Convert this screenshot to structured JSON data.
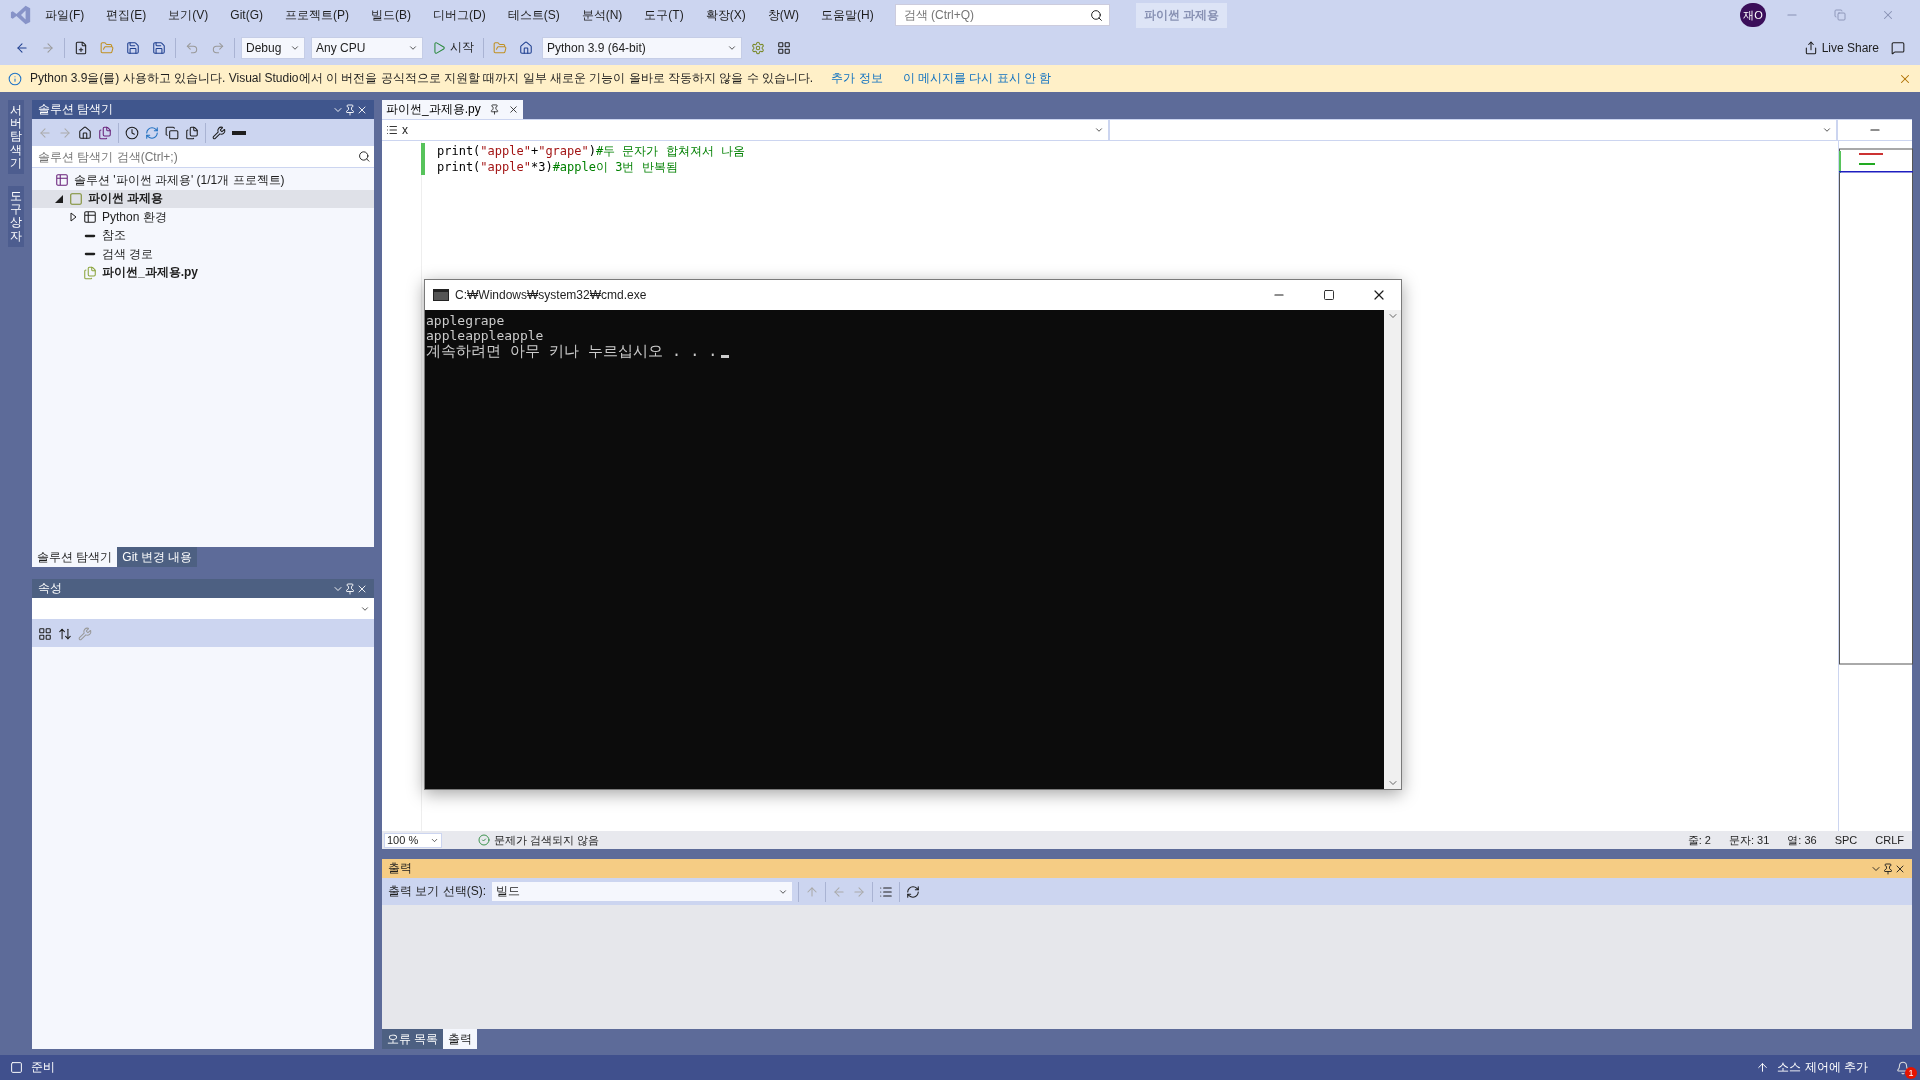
{
  "menu": [
    "파일(F)",
    "편집(E)",
    "보기(V)",
    "Git(G)",
    "프로젝트(P)",
    "빌드(B)",
    "디버그(D)",
    "테스트(S)",
    "분석(N)",
    "도구(T)",
    "확장(X)",
    "창(W)",
    "도움말(H)"
  ],
  "search": {
    "placeholder": "검색 (Ctrl+Q)"
  },
  "solution_badge": "파이썬 과제용",
  "avatar": "재O",
  "toolbar": {
    "configuration": "Debug",
    "platform": "Any CPU",
    "start": "시작",
    "environment": "Python 3.9 (64-bit)",
    "live_share": "Live Share"
  },
  "info_bar": {
    "message": "Python 3.9을(를) 사용하고 있습니다. Visual Studio에서 이 버전을 공식적으로 지원할 때까지 일부 새로운 기능이 올바로 작동하지 않을 수 있습니다.",
    "links": [
      "추가 정보",
      "이 메시지를 다시 표시 안 함"
    ]
  },
  "side_tabs": [
    "서버 탐색기",
    "도구 상자"
  ],
  "solution_explorer": {
    "title": "솔루션 탐색기",
    "search_placeholder": "솔루션 탐색기 검색(Ctrl+;)",
    "tree": [
      {
        "label": "솔루션 '파이썬 과제용' (1/1개 프로젝트)",
        "kind": "solution",
        "selected": false,
        "children": [
          {
            "label": "파이썬 과제용",
            "kind": "project",
            "expanded": true,
            "selected": true,
            "children": [
              {
                "label": "Python 환경",
                "kind": "environment",
                "expanded": false,
                "selected": false
              },
              {
                "label": "참조",
                "kind": "reference",
                "selected": false
              },
              {
                "label": "검색 경로",
                "kind": "reference",
                "selected": false
              },
              {
                "label": "파이썬_과제용.py",
                "kind": "file",
                "selected": false
              }
            ]
          }
        ]
      }
    ],
    "tabs": [
      {
        "label": "솔루션 탐색기",
        "selected": true
      },
      {
        "label": "Git 변경 내용",
        "selected": false
      }
    ]
  },
  "properties": {
    "title": "속성"
  },
  "editor": {
    "tab": "파이썬_과제용.py",
    "nav_scope": "x",
    "lines": [
      [
        {
          "kind": "plain",
          "text": "print("
        },
        {
          "kind": "string",
          "text": "\"apple\""
        },
        {
          "kind": "plain",
          "text": "+"
        },
        {
          "kind": "string",
          "text": "\"grape\""
        },
        {
          "kind": "plain",
          "text": ")"
        },
        {
          "kind": "comment",
          "text": "#두 문자가 합쳐져서 나옴"
        }
      ],
      [
        {
          "kind": "plain",
          "text": "print("
        },
        {
          "kind": "string",
          "text": "\"apple\""
        },
        {
          "kind": "plain",
          "text": "*3)"
        },
        {
          "kind": "comment",
          "text": "#apple이 3번 반복됨"
        }
      ]
    ]
  },
  "editor_status": {
    "zoom": "100 %",
    "issues": "문제가 검색되지 않음",
    "line": "줄: 2",
    "char": "문자: 31",
    "col": "열: 36",
    "whitespace": "SPC",
    "line_ending": "CRLF"
  },
  "output": {
    "title": "출력",
    "source_label": "출력 보기 선택(S):",
    "source": "빌드"
  },
  "bottom_tabs": [
    {
      "label": "오류 목록",
      "selected": false
    },
    {
      "label": "출력",
      "selected": true
    }
  ],
  "console": {
    "title": "C:₩Windows₩system32₩cmd.exe",
    "lines": [
      {
        "kind": "output",
        "text": "applegrape"
      },
      {
        "kind": "output",
        "text": "appleappleapple"
      },
      {
        "kind": "prompt",
        "text": "계속하려면 아무 키나 누르십시오 . . ."
      }
    ]
  },
  "status_bar": {
    "text": "준비",
    "source_control": "소스 제어에 추가",
    "notifications": "1"
  }
}
